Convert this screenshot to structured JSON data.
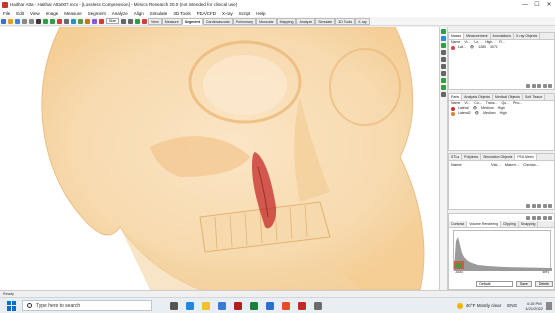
{
  "window": {
    "title": "Haithar Atta - Haithar Atta007.mcs - [Lossless Compression] - Mimics Research 20.0 (not intended for clinical use)",
    "controls": [
      "—",
      "☐",
      "✕"
    ]
  },
  "menu": [
    "File",
    "Edit",
    "View",
    "Image",
    "Measure",
    "Segment",
    "Analyze",
    "Align",
    "Simulate",
    "3D Tools",
    "FEA/CFD",
    "X-ray",
    "Script",
    "Help"
  ],
  "toolbar": {
    "size_label": "Size",
    "view_tabs": [
      "View",
      "Measure",
      "Segment",
      "Cardiovascular",
      "Pulmonary",
      "Muscular",
      "Mapping",
      "Analyze",
      "Simulate",
      "3D Tools",
      "X-ray"
    ],
    "active_tab": "Segment"
  },
  "masks_panel": {
    "tabs": [
      "Masks",
      "Measurement",
      "Annotations",
      "X-ray Objects"
    ],
    "active_tab": "Masks",
    "columns": [
      "Name",
      "Vi...",
      "Lo...",
      "High...",
      "Fi..."
    ],
    "rows": [
      {
        "name": "Lat...",
        "visible": "👁",
        "low": "1280",
        "high": "3071",
        "color": "#e04040"
      }
    ]
  },
  "parts_panel": {
    "tabs": [
      "Parts",
      "Analysis Objects",
      "Medical Objects",
      "Soft Tissue"
    ],
    "active_tab": "Parts",
    "columns": [
      "Name",
      "Vi...",
      "Co...",
      "Trans...",
      "Qu...",
      "Pho..."
    ],
    "rows": [
      {
        "name": "Lateral",
        "visible": "👁",
        "quality": "Medium",
        "pho": "High",
        "color": "#d03030"
      },
      {
        "name": "Lateral2",
        "visible": "👁",
        "quality": "Medium",
        "pho": "High",
        "color": "#e08030"
      }
    ]
  },
  "stl_panel": {
    "tabs": [
      "STLs",
      "Polylines",
      "Simulation Objects",
      "FEA Mesh"
    ],
    "active_tab": "FEA Mesh",
    "columns": [
      "Name",
      "Visi...",
      "Materi...",
      "Contac..."
    ]
  },
  "volume_panel": {
    "tabs": [
      "Contrast",
      "Volume Rendering",
      "Clipping",
      "Snapping"
    ],
    "active_tab": "Volume Rendering",
    "preset": "Default",
    "save_label": "Save",
    "delete_label": "Delete",
    "axis_min": "-1024",
    "axis_max": "3071"
  },
  "status": {
    "text": "Ready"
  },
  "taskbar": {
    "search_placeholder": "Type here to search",
    "weather": "40°F  Mostly clear",
    "language": "ENG",
    "time": "4:15 PM",
    "date": "1/21/2022"
  },
  "colors": {
    "skull_fill": "#f3c98a",
    "skull_dark": "#e8a860",
    "highlight": "#c42a2a",
    "taskbar_bg": "#e9eef3"
  }
}
